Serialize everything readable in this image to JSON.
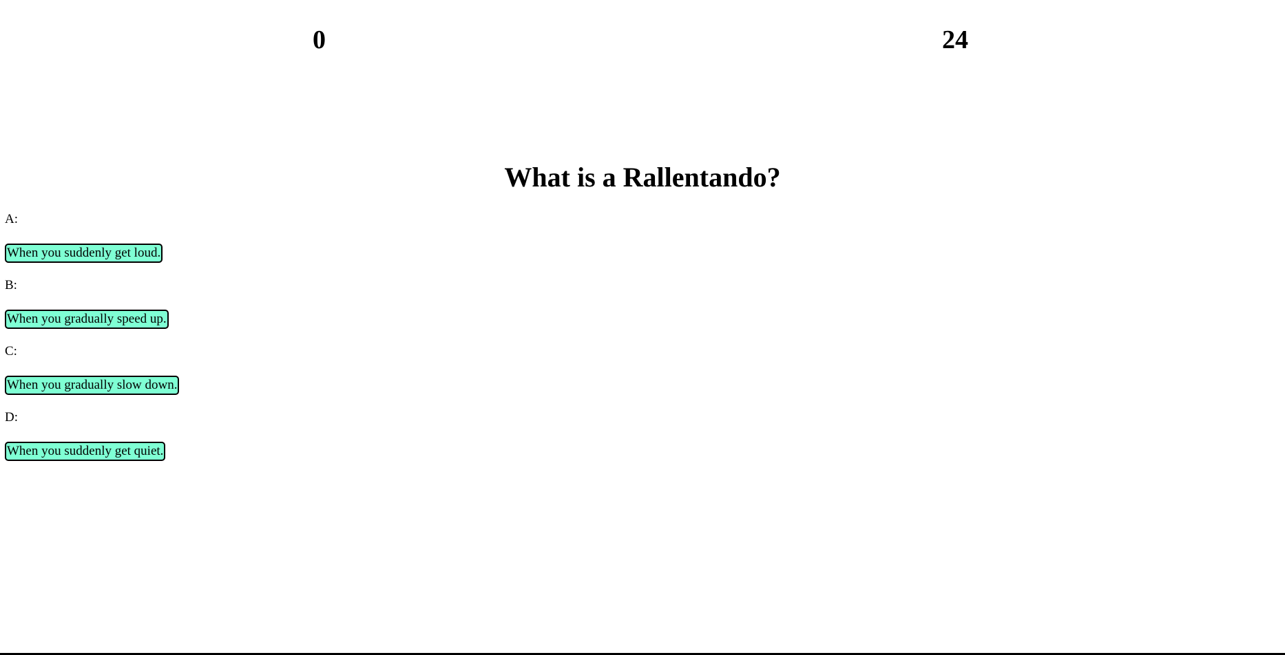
{
  "scores": {
    "left": "0",
    "right": "24"
  },
  "question": {
    "text": "What is a Rallentando?"
  },
  "answers": [
    {
      "label": "A:",
      "text": "When you suddenly get loud."
    },
    {
      "label": "B:",
      "text": "When you gradually speed up."
    },
    {
      "label": "C:",
      "text": "When you gradually slow down."
    },
    {
      "label": "D:",
      "text": "When you suddenly get quiet."
    }
  ],
  "colors": {
    "answer_button_bg": "#7fffd4",
    "border": "#000000",
    "background": "#ffffff"
  }
}
